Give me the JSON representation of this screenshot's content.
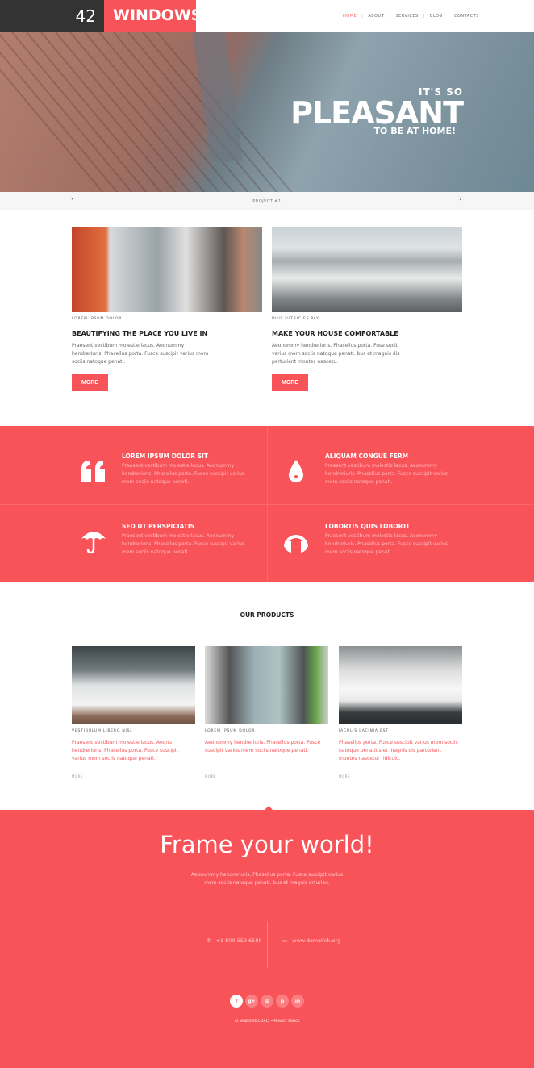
{
  "header": {
    "logo_number": "42",
    "logo_text": "WINDOWS",
    "nav": [
      "HOME",
      "ABOUT",
      "SERVICES",
      "BLOG",
      "CONTACTS"
    ],
    "active": "HOME"
  },
  "hero": {
    "line1": "IT'S SO",
    "line2": "PLEASANT",
    "line3": "TO BE AT HOME!"
  },
  "slider": {
    "label": "PROJECT #1",
    "prev": "‹",
    "next": "›"
  },
  "features": [
    {
      "label": "LOREM IPSUM DOLOR",
      "title": "BEAUTIFYING THE PLACE YOU LIVE IN",
      "text": "Praesent vestibum molestie lacus. Aeonummy hendrerIuris. Phasellus porta. Fusce suscipit varius mem sociis natoque penati.",
      "button": "MORE"
    },
    {
      "label": "DUIS ULTRICIES PAY",
      "title": "MAKE YOUR HOUSE COMFORTABLE",
      "text": "Aeonummy hendreriuris. Phasellus porta. Fuse sucit varius mem sociis natoque penati. bus et magnis dis parturient montes nascetu.",
      "button": "MORE"
    }
  ],
  "services": [
    {
      "icon": "quote-icon",
      "title": "LOREM IPSUM DOLOR SIT",
      "text": "Praesent vestibum molestie lacus. Aeonummy hendreriuris. Phasellus porta. Fusce suscipit varius mem sociis natoque penati."
    },
    {
      "icon": "drop-icon",
      "title": "ALIQUAM CONGUE FERM",
      "text": "Praesent vestibum molestie lacus. Aeonummy hendreriuris. Phasellus porta. Fusce suscipit varius mem sociis natoque penati."
    },
    {
      "icon": "umbrella-icon",
      "title": "SED UT PERSPICIATIS",
      "text": "Praesent vestibum molestie lacus. Aeonummy hendreriuris. Phasellus porta. Fusce suscipit varius mem sociis natoque penati."
    },
    {
      "icon": "headphones-icon",
      "title": "LOBORTIS QUIS LOBORTI",
      "text": "Praesent vestibum molestie lacus. Aeonummy hendreriuris. Phasellus porta. Fusce suscipit varius mem sociis natoque penati."
    }
  ],
  "products": {
    "title": "OUR PRODUCTS",
    "items": [
      {
        "label": "VESTIBULUM LIBERO NISL",
        "text": "Praesent vestibum molestie lacus. Aeonu hendreriuris. Phasellus porta. Fusce suscipit varius mem sociis natoque penati.",
        "more": "MORE"
      },
      {
        "label": "LOREM IPSUM DOLOR",
        "text": "Aeonummy hendreriuris. Phasellus porta. Fusce suscipit varius mem sociis natoque penati.",
        "more": "MORE"
      },
      {
        "label": "IACULIS LACINIA EST",
        "text": "Phasellus porta. Fusce suscipit varius mem sociis natoque penatius et magnis dis parturient montes nascetur ridiculu.",
        "more": "MORE"
      }
    ]
  },
  "footer": {
    "title": "Frame your world!",
    "text": "Aeonummy hendreriuris. Phasellus porta. Fusce suscipit varius mem sociis natoque penati. bus et magnis drturien.",
    "phone": "+1 800 559 6580",
    "website": "www.demolink.org",
    "social": [
      "f",
      "g+",
      "rss",
      "p",
      "in"
    ],
    "copyright": "42 WINDOWS © 2013 • PRIVACY POLICY"
  },
  "colors": {
    "accent": "#f85359",
    "dark": "#333333"
  }
}
